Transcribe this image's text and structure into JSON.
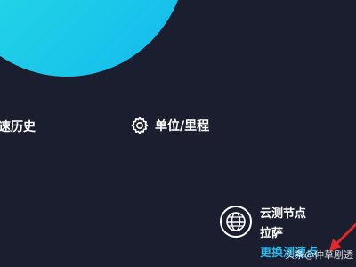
{
  "speed_test": {
    "history_label": "速历史",
    "unit_label": "单位/里程"
  },
  "node": {
    "title": "云测节点",
    "location": "拉萨",
    "change_label": "更换测速点"
  },
  "watermark": "头条@仲草剧透",
  "colors": {
    "background": "#1b1e2e",
    "dial_gradient_start": "#2fe0e4",
    "dial_gradient_end": "#13b9ee",
    "link_blue": "#2fb7ea",
    "arrow_red": "#e0282c"
  },
  "icons": {
    "settings": "gear-icon",
    "node": "globe-icon",
    "annotation": "arrow-icon"
  }
}
